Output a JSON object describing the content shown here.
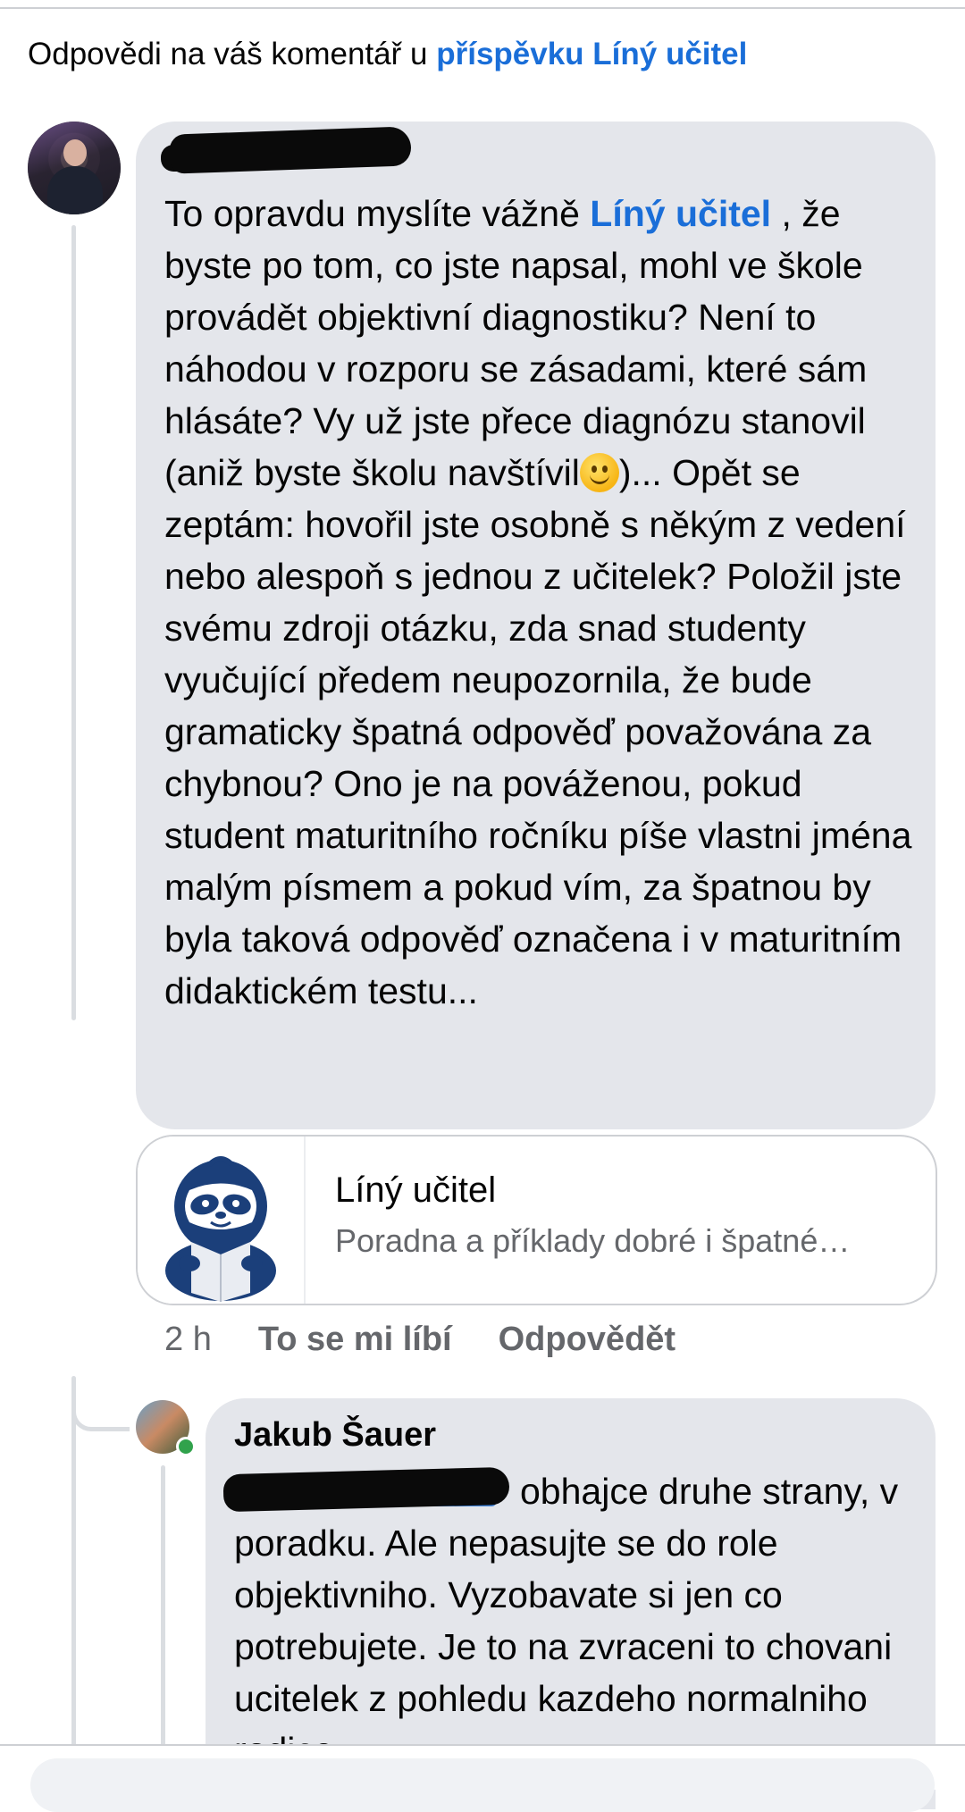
{
  "header": {
    "prefix": "Odpovědi na váš komentář u ",
    "link": "příspěvku Líný učitel"
  },
  "comment": {
    "mention": "Líný učitel",
    "text_before": "To opravdu myslíte vážně ",
    "text_middle": " , že byste po tom, co jste napsal, mohl ve škole provádět objektivní diagnostiku? Není to náhodou v rozporu se zásadami, které sám hlásáte? Vy už jste přece diagnózu stanovil (aniž byste školu navštívil",
    "text_after": ")... Opět se zeptám: hovořil jste osobně s někým z vedení nebo alespoň s jednou z učitelek? Položil jste svému zdroji otázku, zda snad studenty vyučující předem neupozornila, že bude gramaticky špatná odpověď považována za chybnou? Ono je na pováženou, pokud student maturitního ročníku píše vlastni jména malým písmem a pokud vím, za špatnou by byla taková odpověď označena i v maturitním didaktickém testu...",
    "emoji": "slightly-smiling-face"
  },
  "link_card": {
    "title": "Líný učitel",
    "description": "Poradna a příklady dobré i špatné…"
  },
  "meta": {
    "time": "2 h",
    "like": "To se mi líbí",
    "reply": "Odpovědět"
  },
  "reply": {
    "author": "Jakub Šauer",
    "text": "obhajce druhe strany, v poradku. Ale nepasujte se do role objektivniho. Vyzobavate si jen co potrebujete. Je to na zvraceni to chovani ucitelek z pohledu kazdeho normalniho rodice..."
  },
  "colors": {
    "link": "#1a6ed8",
    "bubble": "#e4e6eb",
    "secondary_text": "#65676b",
    "online": "#31a24c"
  }
}
